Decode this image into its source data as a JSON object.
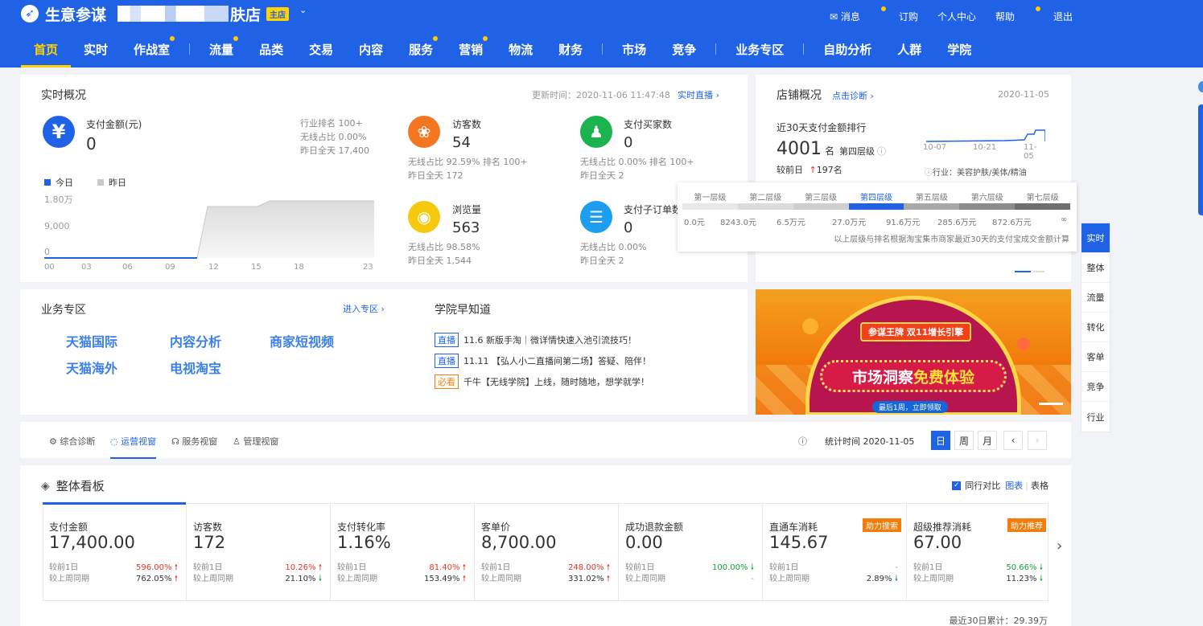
{
  "header": {
    "app_title": "生意参谋",
    "shop_suffix": "肤店",
    "shop_badge": "主店",
    "links": [
      "消息",
      "订购",
      "个人中心",
      "帮助",
      "退出"
    ]
  },
  "nav": [
    "首页",
    "实时",
    "作战室",
    "流量",
    "品类",
    "交易",
    "内容",
    "服务",
    "营销",
    "物流",
    "财务",
    "市场",
    "竞争",
    "业务专区",
    "自助分析",
    "人群",
    "学院"
  ],
  "realtime": {
    "title": "实时概况",
    "update_time": "更新时间：2020-11-06 11:47:48",
    "live_link": "实时直播 ›",
    "pay": {
      "label": "支付金额(元)",
      "value": "0",
      "stats": [
        "行业排名 100+",
        "无线占比 0.00%",
        "昨日全天 17,400"
      ]
    },
    "legend_today": "今日",
    "legend_yesterday": "昨日",
    "chart_ylabels": [
      "1.80万",
      "9,000",
      "0"
    ],
    "chart_xlabels": [
      "00",
      "03",
      "06",
      "09",
      "12",
      "15",
      "18",
      "23"
    ],
    "visitors": {
      "label": "访客数",
      "value": "54",
      "line1": "无线占比  92.59%   排名  100+",
      "line2": "昨日全天  172"
    },
    "buyers": {
      "label": "支付买家数",
      "value": "0",
      "line1": "无线占比  0.00%    排名  100+",
      "line2": "昨日全天  2"
    },
    "pageviews": {
      "label": "浏览量",
      "value": "563",
      "line1": "无线占比  98.58%",
      "line2": "昨日全天  1,544"
    },
    "suborders": {
      "label": "支付子订单数",
      "value": "0",
      "line1": "无线占比  0.00%",
      "line2": "昨日全天  2"
    }
  },
  "shop": {
    "title": "店铺概况",
    "diag_link": "点击诊断 ›",
    "date": "2020-11-05",
    "rank_label": "近30天支付金额排行",
    "rank_value": "4001",
    "rank_unit": "名",
    "tier": "第四层级",
    "compare": "较前日",
    "compare_value": "197名",
    "axis_dates": [
      "10-07",
      "10-21",
      "11-05"
    ],
    "industry": "行业：美容护肤/美体/精油"
  },
  "tiers": {
    "names": [
      "第一层级",
      "第二层级",
      "第三层级",
      "第四层级",
      "第五层级",
      "第六层级",
      "第七层级"
    ],
    "thresholds": [
      "0.0元",
      "8243.0元",
      "6.5万元",
      "27.0万元",
      "91.6万元",
      "285.6万元",
      "872.6万元",
      "∞"
    ],
    "note": "以上层级与排名根据淘宝集市商家最近30天的支付宝成交金额计算"
  },
  "side_tabs": [
    "实时",
    "整体",
    "流量",
    "转化",
    "客单",
    "竞争",
    "行业"
  ],
  "business": {
    "title": "业务专区",
    "enter": "进入专区 ›",
    "links": [
      "天猫国际",
      "内容分析",
      "商家短视频",
      "天猫海外",
      "电视淘宝"
    ]
  },
  "academy": {
    "title": "学院早知道",
    "items": [
      {
        "tag": "直播",
        "text": "11.6 新版手淘｜微详情快速入池引流技巧！"
      },
      {
        "tag": "直播",
        "text": "11.11 【弘人小二直播间第二场】答疑、陪伴！"
      },
      {
        "tag": "必看",
        "text": "千牛【无线学院】上线，随时随地，想学就学！"
      }
    ]
  },
  "banner": {
    "top": "参谋王牌 双11增长引擎",
    "main1": "市场洞察",
    "main2": "免费体验",
    "sub": "最后1周，立即领取"
  },
  "views": {
    "tabs": [
      "综合诊断",
      "运营视窗",
      "服务视窗",
      "管理视窗"
    ],
    "stat_time": "统计时间 2020-11-05",
    "periods": [
      "日",
      "周",
      "月"
    ]
  },
  "board": {
    "title": "整体看板",
    "compare_label": "同行对比",
    "view_chart": "图表",
    "view_table": "表格",
    "kpis": [
      {
        "label": "支付金额",
        "value": "17,400.00",
        "d1": "596.00%",
        "d1dir": "up",
        "d2": "762.05%",
        "d2dir": "up"
      },
      {
        "label": "访客数",
        "value": "172",
        "d1": "10.26%",
        "d1dir": "up",
        "d2": "21.10%",
        "d2dir": "down"
      },
      {
        "label": "支付转化率",
        "value": "1.16%",
        "d1": "81.40%",
        "d1dir": "up",
        "d2": "153.49%",
        "d2dir": "up"
      },
      {
        "label": "客单价",
        "value": "8,700.00",
        "d1": "248.00%",
        "d1dir": "up",
        "d2": "331.02%",
        "d2dir": "up"
      },
      {
        "label": "成功退款金额",
        "value": "0.00",
        "d1": "100.00%",
        "d1dir": "down",
        "d2": "-",
        "d2dir": "none"
      },
      {
        "label": "直通车消耗",
        "value": "145.67",
        "d1": "-",
        "d1dir": "none",
        "d2": "2.89%",
        "d2dir": "down",
        "tag": "助力搜索"
      },
      {
        "label": "超级推荐消耗",
        "value": "67.00",
        "d1": "50.66%",
        "d1dir": "down",
        "d2": "11.23%",
        "d2dir": "down",
        "tag": "助力推荐"
      }
    ],
    "cmp_day": "较前1日",
    "cmp_week": "较上周同期",
    "footer": "最近30日累计：29.39万"
  }
}
